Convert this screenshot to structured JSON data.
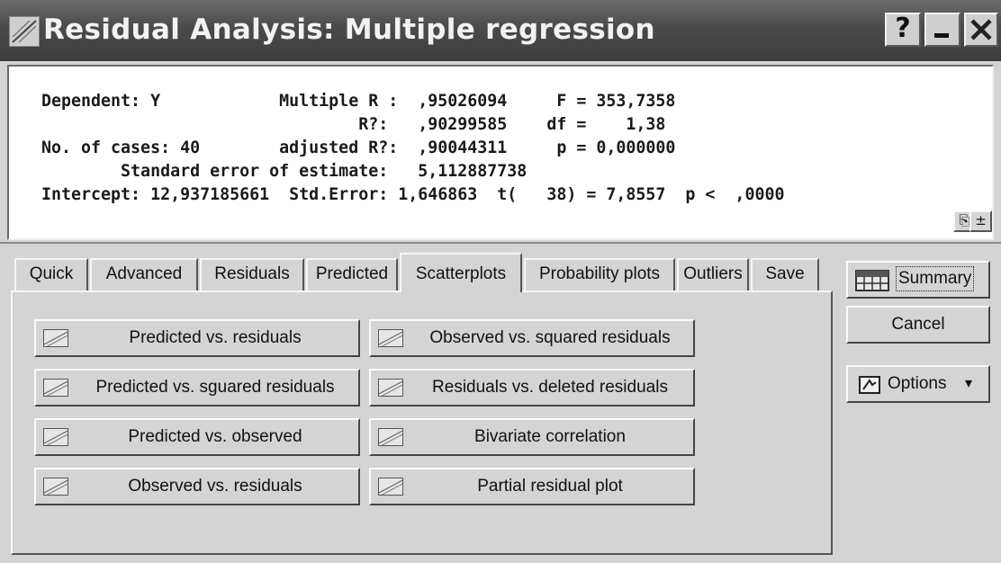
{
  "window": {
    "title": "Residual Analysis: Multiple regression",
    "help_glyph": "?",
    "close_glyph": "✕"
  },
  "output": {
    "lines": [
      "Dependent: Y            Multiple R :  ,95026094     F = 353,7358",
      "                                R?:   ,90299585    df =    1,38",
      "No. of cases: 40        adjusted R?:  ,90044311     p = 0,000000",
      "        Standard error of estimate:   5,112887738",
      "Intercept: 12,937185661  Std.Error: 1,646863  t(   38) = 7,8557  p <  ,0000"
    ],
    "copy_glyph": "⎘",
    "expand_glyph": "±"
  },
  "tabs": [
    {
      "label": "Quick"
    },
    {
      "label": "Advanced"
    },
    {
      "label": "Residuals"
    },
    {
      "label": "Predicted"
    },
    {
      "label": "Scatterplots",
      "active": true
    },
    {
      "label": "Probability plots"
    },
    {
      "label": "Outliers"
    },
    {
      "label": "Save"
    }
  ],
  "buttons": {
    "predicted_vs_residuals": "Predicted vs. residuals",
    "observed_vs_squared_residuals": "Observed vs. squared residuals",
    "predicted_vs_squared_residuals": "Predicted vs. sguared residuals",
    "residuals_vs_deleted_residuals": "Residuals vs. deleted residuals",
    "predicted_vs_observed": "Predicted vs. observed",
    "bivariate_correlation": "Bivariate correlation",
    "observed_vs_residuals": "Observed vs. residuals",
    "partial_residual_plot": "Partial residual plot"
  },
  "side": {
    "summary": "Summary",
    "cancel": "Cancel",
    "options": "Options",
    "options_arrow": "▾"
  }
}
